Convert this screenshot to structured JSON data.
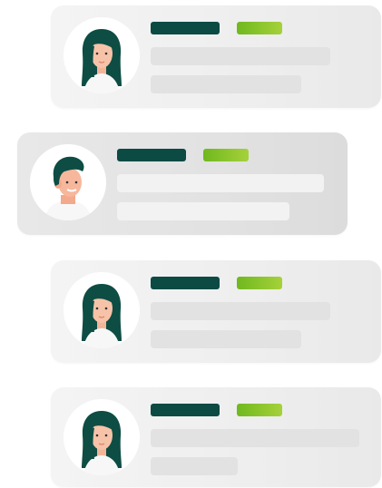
{
  "cards": [
    {
      "avatar": "woman-avatar-icon",
      "active": false
    },
    {
      "avatar": "man-avatar-icon",
      "active": true
    },
    {
      "avatar": "woman-avatar-icon",
      "active": false
    },
    {
      "avatar": "woman-avatar-icon",
      "active": false
    }
  ],
  "colors": {
    "name_bar": "#0c4a44",
    "tag_bar": "#8cc42a",
    "line_bar": "#e2e2e2",
    "card_bg": "#efefef"
  }
}
